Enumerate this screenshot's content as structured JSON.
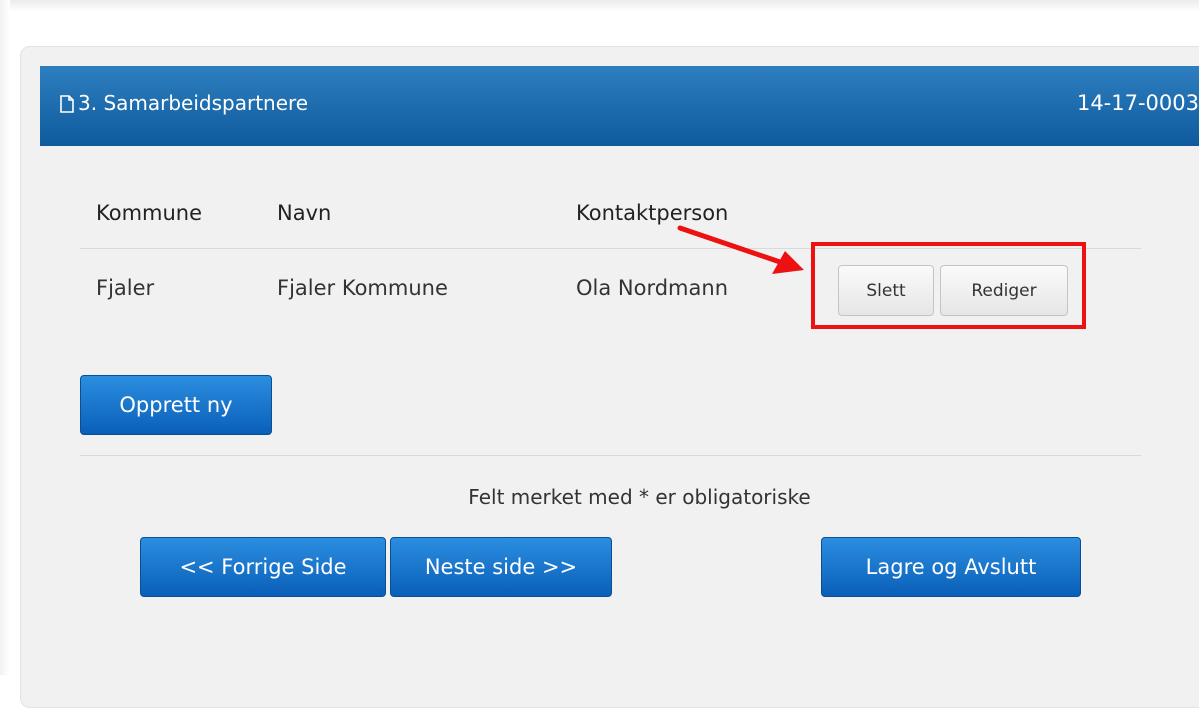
{
  "header": {
    "title": "3. Samarbeidspartnere",
    "reference": "14-17-0003"
  },
  "table": {
    "columns": [
      "Kommune",
      "Navn",
      "Kontaktperson"
    ],
    "rows": [
      {
        "kommune": "Fjaler",
        "navn": "Fjaler Kommune",
        "kontaktperson": "Ola Nordmann"
      }
    ],
    "row_actions": {
      "delete_label": "Slett",
      "edit_label": "Rediger"
    }
  },
  "create_button": "Opprett ny",
  "required_note": "Felt merket med * er obligatoriske",
  "navigation": {
    "previous_label": "<< Forrige Side",
    "next_label": "Neste side >>",
    "save_exit_label": "Lagre og Avslutt"
  },
  "annotation": {
    "color": "#ee1111"
  },
  "colors": {
    "header": "#1a6aab",
    "primary_button": "#0e6cc8",
    "panel": "#f1f1f1"
  }
}
